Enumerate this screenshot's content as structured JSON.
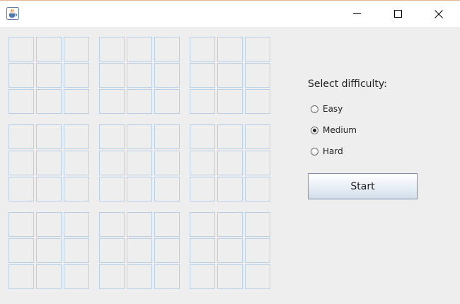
{
  "window": {
    "icon": "java-cup-icon",
    "controls": [
      "minimize-icon",
      "maximize-icon",
      "close-icon"
    ]
  },
  "board": {
    "boxes": 9,
    "cells_per_box": 9,
    "cell_border_color": "#b8cfe5",
    "cells": []
  },
  "difficulty": {
    "label": "Select difficulty:",
    "options": [
      {
        "label": "Easy",
        "selected": false
      },
      {
        "label": "Medium",
        "selected": true
      },
      {
        "label": "Hard",
        "selected": false
      }
    ]
  },
  "start_button": {
    "label": "Start"
  },
  "colors": {
    "background": "#eeeeee",
    "titlebar": "#ffffff",
    "frame_border": "#e8b892"
  }
}
